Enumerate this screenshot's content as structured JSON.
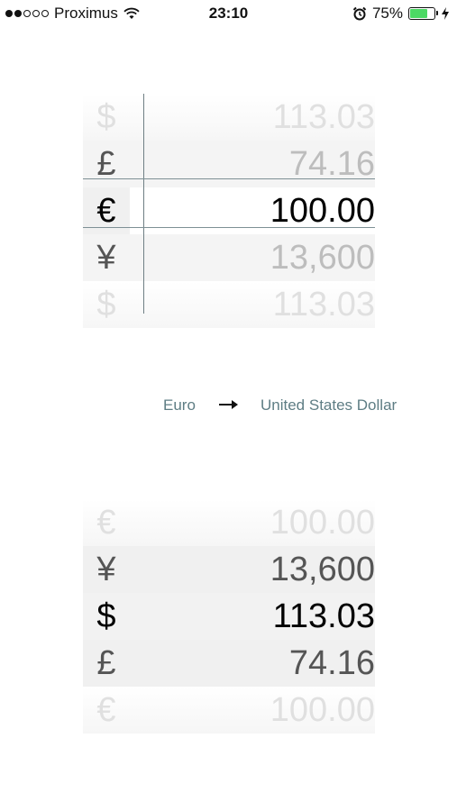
{
  "status_bar": {
    "carrier": "Proximus",
    "time": "23:10",
    "battery_percent": "75%",
    "battery_level": 0.75,
    "signal_dots_filled": 2,
    "signal_dots_total": 5
  },
  "top_picker": {
    "rows": [
      {
        "symbol": "$",
        "amount": "113.03"
      },
      {
        "symbol": "£",
        "amount": "74.16"
      },
      {
        "symbol": "€",
        "amount": "100.00"
      },
      {
        "symbol": "¥",
        "amount": "13,600"
      },
      {
        "symbol": "$",
        "amount": "113.03"
      }
    ],
    "selected_index": 2
  },
  "conversion": {
    "from": "Euro",
    "to": "United States Dollar"
  },
  "bottom_picker": {
    "rows": [
      {
        "symbol": "€",
        "amount": "100.00"
      },
      {
        "symbol": "¥",
        "amount": "13,600"
      },
      {
        "symbol": "$",
        "amount": "113.03"
      },
      {
        "symbol": "£",
        "amount": "74.16"
      },
      {
        "symbol": "€",
        "amount": "100.00"
      }
    ],
    "selected_index": 2
  },
  "colors": {
    "accent": "#5e7d84",
    "divider": "#7e9095",
    "battery": "#4cd964"
  }
}
